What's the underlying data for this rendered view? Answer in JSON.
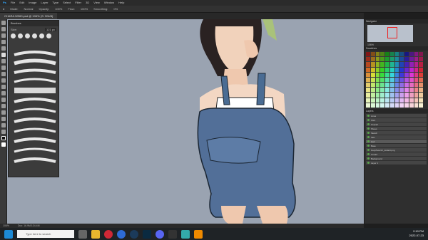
{
  "app": {
    "name": "Adobe Photoshop"
  },
  "menubar": {
    "items": [
      "File",
      "Edit",
      "Image",
      "Layer",
      "Type",
      "Select",
      "Filter",
      "3D",
      "View",
      "Window",
      "Help"
    ]
  },
  "optionsbar": {
    "items": [
      "Mode:",
      "Normal",
      "Opacity:",
      "100%",
      "Flow:",
      "100%",
      "Smoothing:",
      "0%"
    ]
  },
  "document_tab": {
    "title": "CHARA.W360.psd @ 106% (S: 904/8)"
  },
  "brush_panel": {
    "title": "Brushes",
    "size_label": "Size:",
    "size_value": "121 px"
  },
  "right_panel": {
    "navigator_title": "Navigator",
    "zoom": "106%",
    "swatches_title": "Swatches",
    "layers_title": "Layers",
    "layers": [
      "Lines",
      "Shirt",
      "Overall",
      "Shoes",
      "Sketch",
      "Skin",
      "Hair",
      "Base",
      "body/face/ch_default.png",
      "Lineart",
      "Background",
      "Layer 1"
    ],
    "selected_layer_index": 6
  },
  "statusbar": {
    "zoom": "106%",
    "doc": "Doc: 16.9M/134.4M"
  },
  "taskbar": {
    "search_placeholder": "Type here to search",
    "time": "2:10 PM",
    "date": "2022-07-23"
  }
}
